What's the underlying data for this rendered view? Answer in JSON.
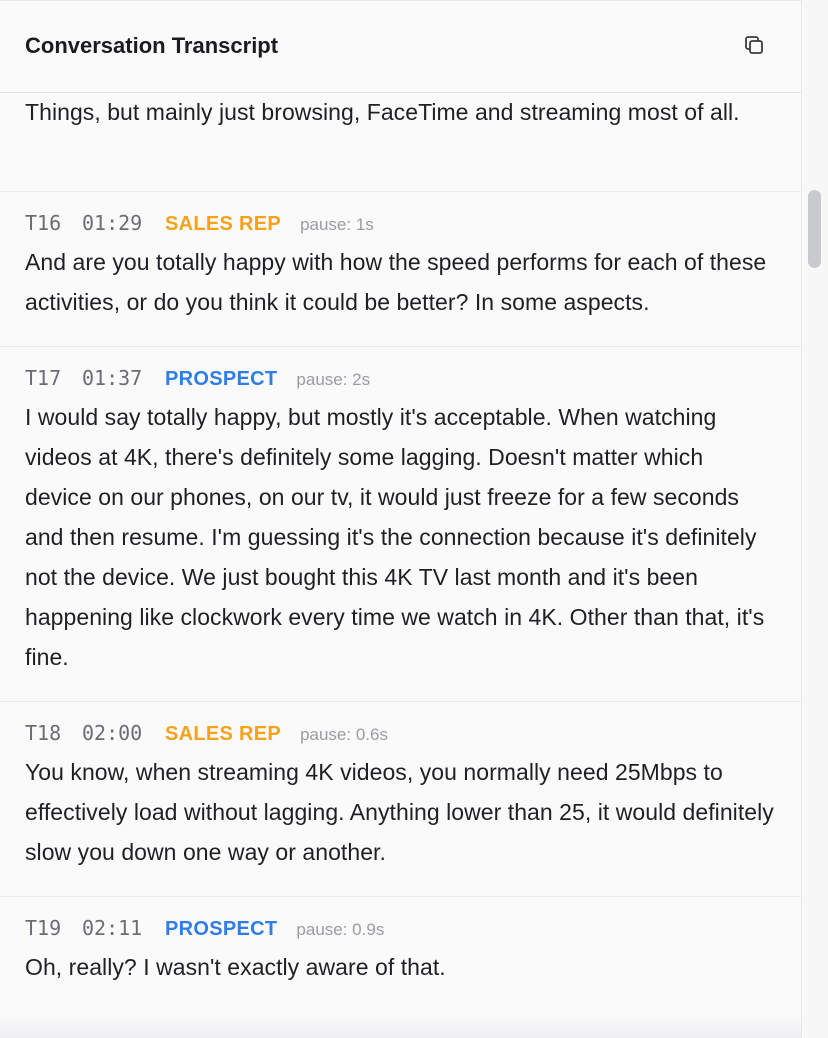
{
  "header": {
    "title": "Conversation Transcript",
    "copy_icon": "copy-icon"
  },
  "partial_turn": {
    "text": "Things, but mainly just browsing, FaceTime and streaming most of all."
  },
  "turns": [
    {
      "id": "T16",
      "time": "01:29",
      "speaker": "SALES REP",
      "pause": "pause: 1s",
      "text": "And are you totally happy with how the speed performs for each of these activities, or do you think it could be better? In some aspects."
    },
    {
      "id": "T17",
      "time": "01:37",
      "speaker": "PROSPECT",
      "pause": "pause: 2s",
      "text": "I would say totally happy, but mostly it's acceptable. When watching videos at 4K, there's definitely some lagging. Doesn't matter which device on our phones, on our tv, it would just freeze for a few seconds and then resume. I'm guessing it's the connection because it's definitely not the device. We just bought this 4K TV last month and it's been happening like clockwork every time we watch in 4K. Other than that, it's fine."
    },
    {
      "id": "T18",
      "time": "02:00",
      "speaker": "SALES REP",
      "pause": "pause: 0.6s",
      "text": "You know, when streaming 4K videos, you normally need 25Mbps to effectively load without lagging. Anything lower than 25, it would definitely slow you down one way or another."
    },
    {
      "id": "T19",
      "time": "02:11",
      "speaker": "PROSPECT",
      "pause": "pause: 0.9s",
      "text": "Oh, really? I wasn't exactly aware of that."
    }
  ],
  "colors": {
    "sales_rep": "#f5a21a",
    "prospect": "#2f7de8",
    "text": "#1f2024",
    "muted": "#6b6d73"
  }
}
